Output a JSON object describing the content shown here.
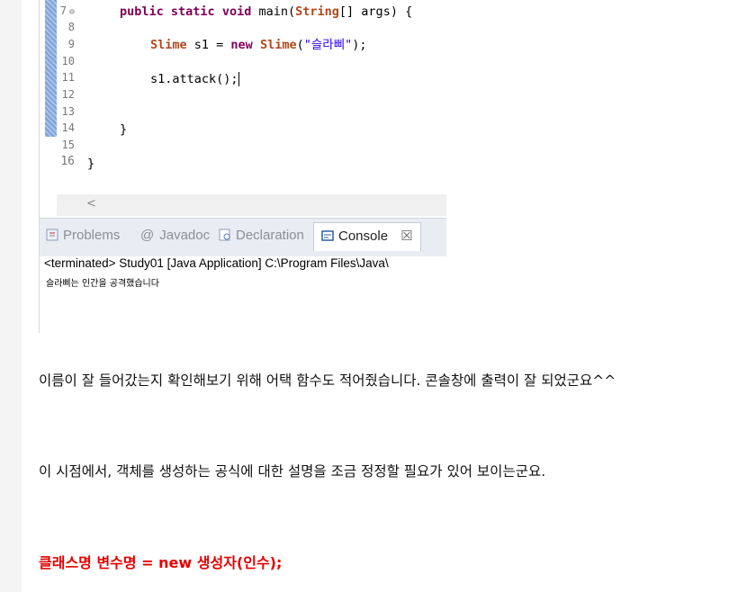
{
  "editor": {
    "line_numbers": [
      "7",
      "8",
      "9",
      "10",
      "11",
      "12",
      "13",
      "14",
      "15",
      "16"
    ],
    "fold_marker": "⊖",
    "line7": {
      "kw1": "public",
      "kw2": "static",
      "kw3": "void",
      "name": " main(",
      "type": "String",
      "rest": "[] args) {"
    },
    "line9": {
      "type1": "Slime",
      "var": " s1 = ",
      "kw": "new",
      "type2": "Slime",
      "open": "(",
      "str": "\"슬라삐\"",
      "close": ");"
    },
    "line11": {
      "text": "s1.attack();"
    },
    "line14": {
      "text": "}"
    },
    "line16": {
      "text": "}"
    },
    "scroll_left": "<"
  },
  "tabs": {
    "problems": "Problems",
    "javadoc": "Javadoc",
    "declaration": "Declaration",
    "console": "Console",
    "close": "☒"
  },
  "console": {
    "header": "<terminated> Study01 [Java Application] C:\\Program Files\\Java\\",
    "output": "슬라삐는 인간을 공격했습니다"
  },
  "article": {
    "p1": "이름이 잘 들어갔는지 확인해보기 위해 어택 함수도 적어줬습니다. 콘솔창에 출력이 잘 되었군요^^",
    "p2": "이 시점에서, 객체를 생성하는 공식에 대한 설명을 조금 정정할 필요가 있어 보이는군요.",
    "p3": "클래스명 변수명 = new 생성자(인수);"
  },
  "colors": {
    "keyword": "#7f0055",
    "type": "#b1481b",
    "string": "#2a00ff",
    "highlight": "#e60000"
  }
}
